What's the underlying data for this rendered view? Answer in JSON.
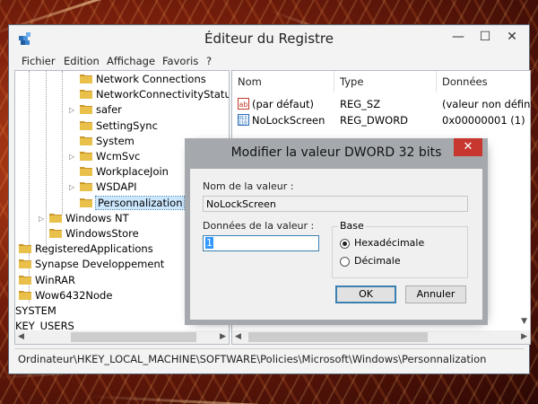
{
  "window": {
    "title": "Éditeur du Registre",
    "minimize_glyph": "—",
    "maximize_glyph": "☐",
    "close_glyph": "✕"
  },
  "menu": [
    "Fichier",
    "Edition",
    "Affichage",
    "Favoris",
    "?"
  ],
  "tree": [
    {
      "label": "Network Connections",
      "level": 3,
      "expander": ""
    },
    {
      "label": "NetworkConnectivityStatu",
      "level": 3,
      "expander": ""
    },
    {
      "label": "safer",
      "level": 3,
      "expander": "▷"
    },
    {
      "label": "SettingSync",
      "level": 3,
      "expander": ""
    },
    {
      "label": "System",
      "level": 3,
      "expander": ""
    },
    {
      "label": "WcmSvc",
      "level": 3,
      "expander": "▷"
    },
    {
      "label": "WorkplaceJoin",
      "level": 3,
      "expander": ""
    },
    {
      "label": "WSDAPI",
      "level": 3,
      "expander": "▷"
    },
    {
      "label": "Personnalization",
      "level": 3,
      "expander": "",
      "selected": true
    },
    {
      "label": "Windows NT",
      "level": 2,
      "expander": "▷"
    },
    {
      "label": "WindowsStore",
      "level": 2,
      "expander": ""
    },
    {
      "label": "RegisteredApplications",
      "level": 1,
      "expander": ""
    },
    {
      "label": "Synapse Developpement",
      "level": 1,
      "expander": ""
    },
    {
      "label": "WinRAR",
      "level": 1,
      "expander": ""
    },
    {
      "label": "Wow6432Node",
      "level": 1,
      "expander": ""
    },
    {
      "label": "SYSTEM",
      "level": 0,
      "expander": "",
      "nofolder": true
    },
    {
      "label": "KEY_USERS",
      "level": 0,
      "expander": "",
      "nofolder": true
    }
  ],
  "list": {
    "columns": [
      "Nom",
      "Type",
      "Données"
    ],
    "rows": [
      {
        "name": "(par défaut)",
        "type": "REG_SZ",
        "data": "(valeur non définie)",
        "icon": "string-value-icon"
      },
      {
        "name": "NoLockScreen",
        "type": "REG_DWORD",
        "data": "0x00000001 (1)",
        "icon": "dword-value-icon"
      }
    ]
  },
  "status_path": "Ordinateur\\HKEY_LOCAL_MACHINE\\SOFTWARE\\Policies\\Microsoft\\Windows\\Personnalization",
  "dialog": {
    "title": "Modifier la valeur DWORD 32 bits",
    "close_glyph": "✕",
    "name_label": "Nom de la valeur :",
    "name_value": "NoLockScreen",
    "data_label": "Données de la valeur :",
    "data_value": "1",
    "base_label": "Base",
    "radio_hex": "Hexadécimale",
    "radio_dec": "Décimale",
    "selected_base": "hex",
    "ok_label": "OK",
    "cancel_label": "Annuler"
  },
  "colors": {
    "folder": "#e8c04a",
    "folder_dark": "#c9972a",
    "selection": "#cce8ff",
    "dialog_close": "#c7372f"
  }
}
